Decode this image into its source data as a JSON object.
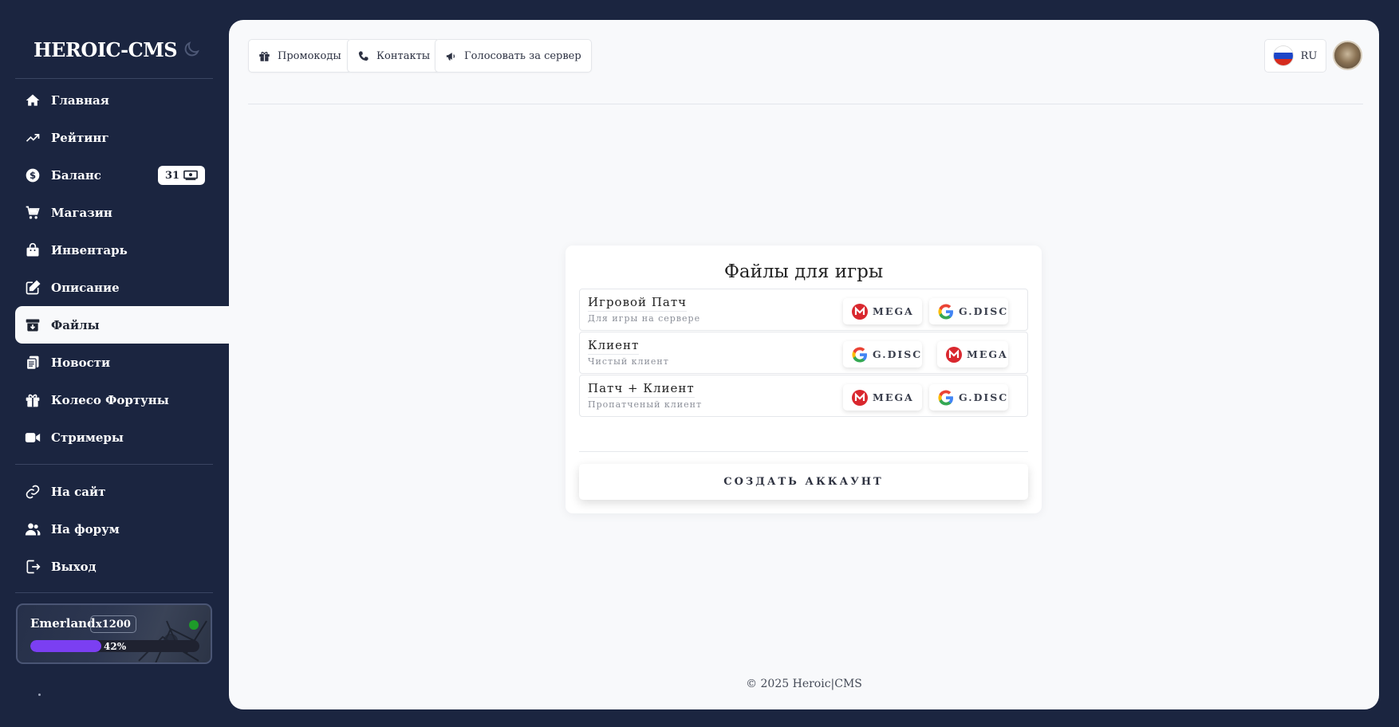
{
  "brand": {
    "title": "HEROIC-CMS"
  },
  "sidebar": {
    "items": [
      {
        "label": "Главная",
        "icon": "home-icon"
      },
      {
        "label": "Рейтинг",
        "icon": "trending-up-icon"
      },
      {
        "label": "Баланс",
        "icon": "dollar-icon",
        "badge": "31"
      },
      {
        "label": "Магазин",
        "icon": "cart-icon"
      },
      {
        "label": "Инвентарь",
        "icon": "bag-icon"
      },
      {
        "label": "Описание",
        "icon": "edit-icon"
      },
      {
        "label": "Файлы",
        "icon": "archive-icon",
        "active": true
      },
      {
        "label": "Новости",
        "icon": "clipboard-icon"
      },
      {
        "label": "Колесо Фортуны",
        "icon": "gift-icon"
      },
      {
        "label": "Стримеры",
        "icon": "video-icon"
      }
    ],
    "links": [
      {
        "label": "На сайт",
        "icon": "link-icon"
      },
      {
        "label": "На форум",
        "icon": "users-icon"
      },
      {
        "label": "Выход",
        "icon": "logout-icon"
      }
    ],
    "server": {
      "name": "Emerland",
      "rate": "x1200",
      "progress_label": "42%",
      "progress": 0.42,
      "status_color": "#1e9b2a"
    }
  },
  "topbar": {
    "promo_label": "Промокоды",
    "contacts_label": "Контакты",
    "vote_label": "Голосовать за сервер",
    "lang_label": "RU"
  },
  "files": {
    "title": "Файлы для игры",
    "rows": [
      {
        "name": "Игровой Патч",
        "desc": "Для игры на сервере",
        "buttons": [
          "MEGA",
          "G.DISC"
        ]
      },
      {
        "name": "Клиент",
        "desc": "Чистый клиент",
        "buttons": [
          "G.DISC",
          "MEGA"
        ]
      },
      {
        "name": "Патч + Клиент",
        "desc": "Пропатченый клиент",
        "buttons": [
          "MEGA",
          "G.DISC"
        ]
      }
    ],
    "create_label": "СОЗДАТЬ АККАУНТ"
  },
  "footer": {
    "text": "© 2025 Heroic|CMS"
  },
  "colors": {
    "sidebar_bg": "#1b2540",
    "accent": "#7b3ff2",
    "mega": "#d9272e"
  }
}
